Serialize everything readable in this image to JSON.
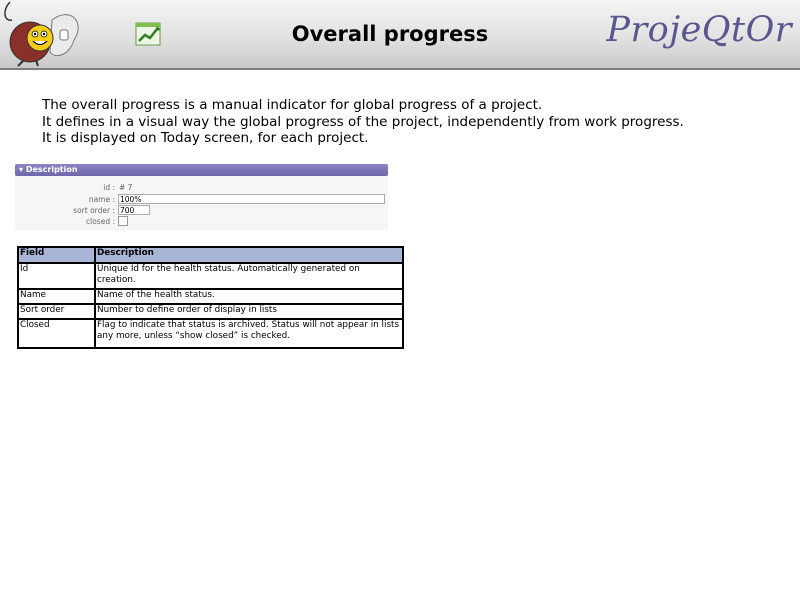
{
  "header": {
    "title": "Overall progress",
    "brand": "ProjeQtOr",
    "icons": [
      "projeqtor-mascot-logo",
      "progress-chart-icon"
    ]
  },
  "intro": {
    "lines": [
      "The overall progress is a manual indicator for global progress of a project.",
      "It defines in a visual way the global progress of the project, independently from work progress.",
      "It is displayed on Today screen, for each project."
    ]
  },
  "description_panel": {
    "title": "Description",
    "fields": [
      {
        "label": "id :",
        "value": "# 7"
      },
      {
        "label": "name :",
        "value": "100%"
      },
      {
        "label": "sort order :",
        "value": "700"
      },
      {
        "label": "closed :",
        "value": ""
      }
    ]
  },
  "fields_table": {
    "headers": [
      "Field",
      "Description"
    ],
    "rows": [
      [
        "Id",
        "Unique Id for the health status. Automatically generated on creation."
      ],
      [
        "Name",
        "Name of the health status."
      ],
      [
        "Sort order",
        "Number to define order of display in lists"
      ],
      [
        "Closed",
        "Flag to indicate that status is archived. Status will not appear in lists any more, unless “show closed” is checked."
      ]
    ]
  },
  "colors": {
    "brand": "#5a568e",
    "panel_header": "#7a74b6",
    "table_header": "#a9b5d6"
  }
}
